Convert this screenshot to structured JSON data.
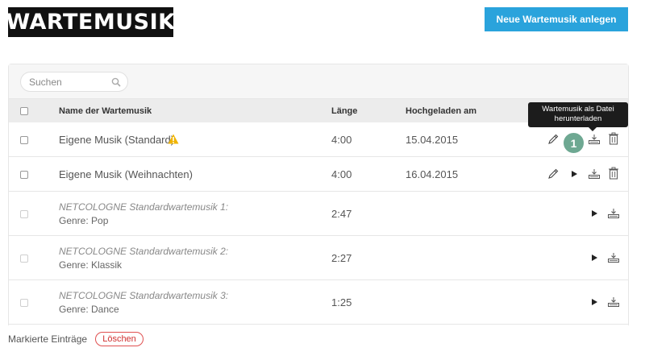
{
  "header": {
    "logo_text": "WARTEMUSIK",
    "new_button_label": "Neue Wartemusik anlegen"
  },
  "search": {
    "placeholder": "Suchen"
  },
  "table": {
    "columns": {
      "name": "Name der Wartemusik",
      "length": "Länge",
      "uploaded": "Hochgeladen am"
    },
    "rows": [
      {
        "name": "Eigene Musik (Standard)",
        "warning": true,
        "length": "4:00",
        "uploaded": "15.04.2015",
        "actions": [
          "pencil-icon",
          "play-icon",
          "download-icon",
          "trash-icon"
        ]
      },
      {
        "name": "Eigene Musik (Weihnachten)",
        "length": "4:00",
        "uploaded": "16.04.2015",
        "actions": [
          "pencil-icon",
          "play-icon",
          "download-icon",
          "trash-icon"
        ]
      },
      {
        "title": "NETCOLOGNE Standardwartemusik 1:",
        "genre": "Genre: Pop",
        "length": "2:47",
        "actions": [
          "play-icon",
          "download-icon"
        ]
      },
      {
        "title": "NETCOLOGNE Standardwartemusik 2:",
        "genre": "Genre: Klassik",
        "length": "2:27",
        "actions": [
          "play-icon",
          "download-icon"
        ]
      },
      {
        "title": "NETCOLOGNE Standardwartemusik 3:",
        "genre": "Genre: Dance",
        "length": "1:25",
        "actions": [
          "play-icon",
          "download-icon"
        ]
      }
    ]
  },
  "tooltip": {
    "line1": "Wartemusik als Datei",
    "line2": "herunterladen"
  },
  "badge": {
    "number": "1"
  },
  "footer": {
    "label": "Markierte Einträge",
    "delete_label": "Löschen"
  },
  "colors": {
    "accent": "#2aa3dc",
    "warning": "#f0b400",
    "badge": "#6ea892",
    "delete": "#d03030"
  }
}
